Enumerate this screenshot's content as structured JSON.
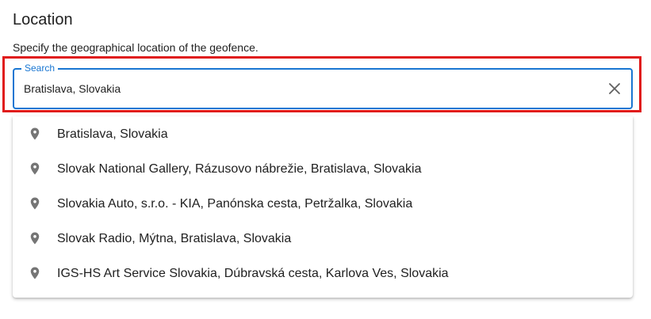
{
  "section": {
    "title": "Location",
    "description": "Specify the geographical location of the geofence."
  },
  "search": {
    "label": "Search",
    "value": "Bratislava, Slovakia",
    "clear_icon": "close-icon",
    "accent_color": "#1976d2",
    "highlight_color": "#e01b1b"
  },
  "suggestions": [
    {
      "icon": "map-pin-icon",
      "label": "Bratislava, Slovakia"
    },
    {
      "icon": "map-pin-icon",
      "label": "Slovak National Gallery, Rázusovo nábrežie, Bratislava, Slovakia"
    },
    {
      "icon": "map-pin-icon",
      "label": "Slovakia Auto, s.r.o. - KIA, Panónska cesta, Petržalka, Slovakia"
    },
    {
      "icon": "map-pin-icon",
      "label": "Slovak Radio, Mýtna, Bratislava, Slovakia"
    },
    {
      "icon": "map-pin-icon",
      "label": "IGS-HS Art Service Slovakia, Dúbravská cesta, Karlova Ves, Slovakia"
    }
  ]
}
